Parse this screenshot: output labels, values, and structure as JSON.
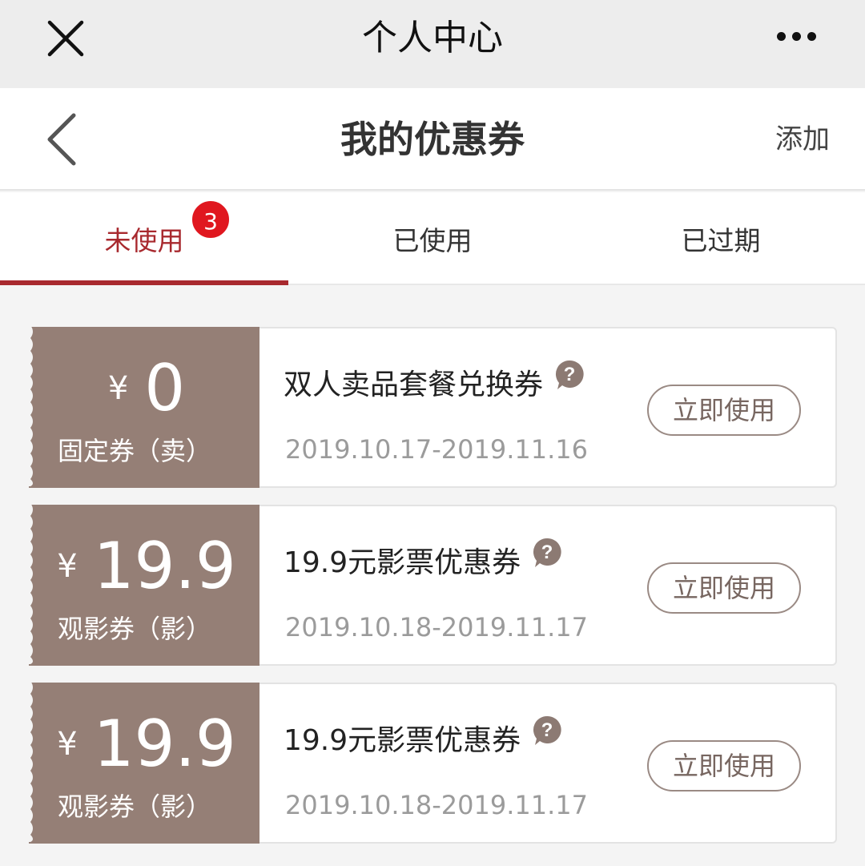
{
  "wechat_bar": {
    "title": "个人中心",
    "close_icon": "close-icon",
    "more_icon": "more-icon"
  },
  "nav": {
    "title": "我的优惠券",
    "add_label": "添加",
    "back_icon": "chevron-left-icon"
  },
  "tabs": [
    {
      "label": "未使用",
      "badge": "3",
      "active": true
    },
    {
      "label": "已使用",
      "active": false
    },
    {
      "label": "已过期",
      "active": false
    }
  ],
  "colors": {
    "accent": "#a8292e",
    "stub": "#957f76",
    "badge": "#e0171f"
  },
  "coupons": [
    {
      "currency": "¥",
      "amount": "0",
      "type": "固定券（卖）",
      "name": "双人卖品套餐兑换券",
      "date_range": "2019.10.17-2019.11.16",
      "button": "立即使用"
    },
    {
      "currency": "¥",
      "amount": "19.9",
      "type": "观影券（影）",
      "name": "19.9元影票优惠券",
      "date_range": "2019.10.18-2019.11.17",
      "button": "立即使用"
    },
    {
      "currency": "¥",
      "amount": "19.9",
      "type": "观影券（影）",
      "name": "19.9元影票优惠券",
      "date_range": "2019.10.18-2019.11.17",
      "button": "立即使用"
    }
  ]
}
